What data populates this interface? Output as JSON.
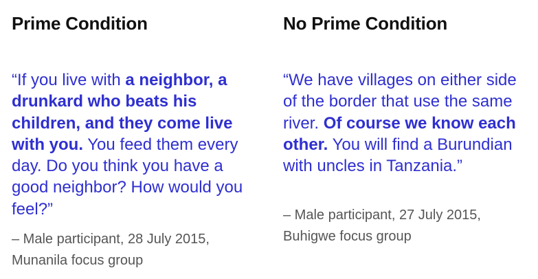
{
  "left": {
    "heading": "Prime Condition",
    "quote": {
      "p1": "“If you live with ",
      "b1": "a neighbor, a drunkard who beats his children, and they come live with you.",
      "p2": " You feed them every day. Do you think you have a good neighbor? How would you feel?”"
    },
    "attribution_line1": "– Male participant, 28 July 2015,",
    "attribution_line2": "Munanila focus group"
  },
  "right": {
    "heading": "No Prime Condition",
    "quote": {
      "p1": "“We have villages on either side of the border that use the same river. ",
      "b1": "Of course we know each other.",
      "p2": " You will find a Burundian with uncles in Tanzania.”"
    },
    "attribution_line1": "– Male participant, 27 July 2015,",
    "attribution_line2": "Buhigwe focus group"
  },
  "colors": {
    "quote_text": "#2f2fd0",
    "heading_text": "#111111",
    "attribution_text": "#555555"
  }
}
